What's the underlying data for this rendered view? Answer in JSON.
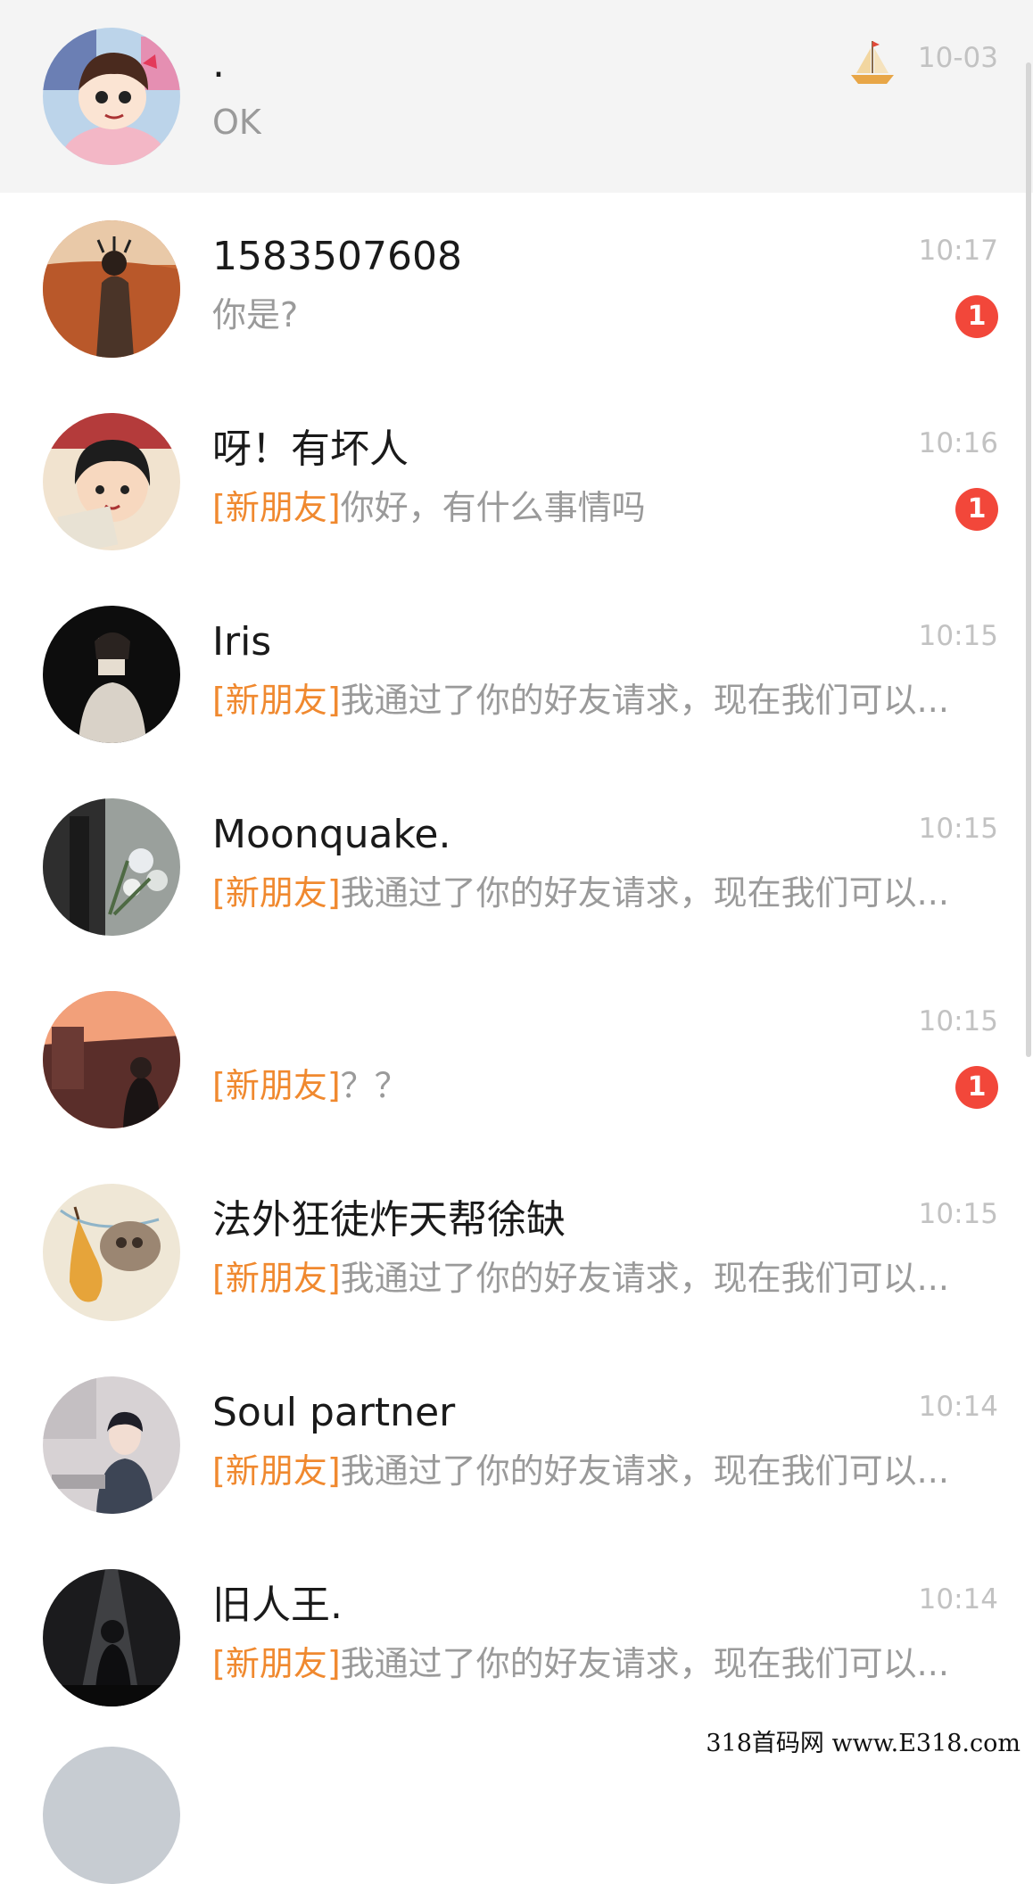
{
  "chats": [
    {
      "name": ".",
      "tag": "",
      "preview": "OK",
      "time": "10-03",
      "badge": "",
      "icon": "sailboat-icon",
      "avatar": "cartoon-girl"
    },
    {
      "name": "1583507608",
      "tag": "",
      "preview": "你是?",
      "time": "10:17",
      "badge": "1",
      "avatar": "field-person"
    },
    {
      "name": "呀！有坏人",
      "tag": "[新朋友]",
      "preview": "你好，有什么事情吗",
      "time": "10:16",
      "badge": "1",
      "avatar": "anime-boy"
    },
    {
      "name": "Iris",
      "tag": "[新朋友]",
      "preview": "我通过了你的好友请求，现在我们可以...",
      "time": "10:15",
      "badge": "",
      "avatar": "dark-portrait"
    },
    {
      "name": "Moonquake.",
      "tag": "[新朋友]",
      "preview": "我通过了你的好友请求，现在我们可以...",
      "time": "10:15",
      "badge": "",
      "avatar": "flowers"
    },
    {
      "name": "",
      "tag": "[新朋友]",
      "preview": "？？",
      "time": "10:15",
      "badge": "1",
      "avatar": "sunset-city"
    },
    {
      "name": "法外狂徒炸天帮徐缺",
      "tag": "[新朋友]",
      "preview": "我通过了你的好友请求，现在我们可以...",
      "time": "10:15",
      "badge": "",
      "avatar": "owl-pear"
    },
    {
      "name": "Soul partner",
      "tag": "[新朋友]",
      "preview": "我通过了你的好友请求，现在我们可以...",
      "time": "10:14",
      "badge": "",
      "avatar": "illustrated-boy"
    },
    {
      "name": "旧人王.",
      "tag": "[新朋友]",
      "preview": "我通过了你的好友请求，现在我们可以...",
      "time": "10:14",
      "badge": "",
      "avatar": "concert-silhouette"
    }
  ],
  "watermark": "318首码网 www.E318.com",
  "colors": {
    "tag": "#f0892f",
    "badge": "#f2473a",
    "pinned_bg": "#f4f4f4"
  }
}
